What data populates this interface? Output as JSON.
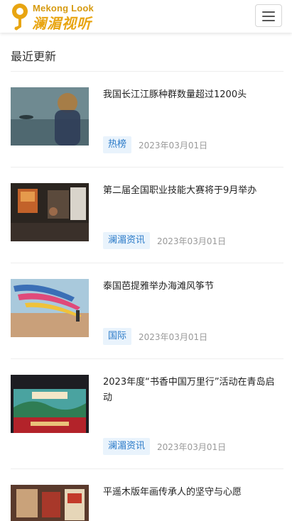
{
  "header": {
    "logo_en": "Mekong Look",
    "logo_cn": "澜湄视听",
    "menu_icon": "hamburger-menu-icon"
  },
  "section": {
    "title": "最近更新"
  },
  "articles": [
    {
      "title": "我国长江江豚种群数量超过1200头",
      "tag": "热榜",
      "date": "2023年03月01日"
    },
    {
      "title": "第二届全国职业技能大赛将于9月举办",
      "tag": "澜湄资讯",
      "date": "2023年03月01日"
    },
    {
      "title": "泰国芭提雅举办海滩风筝节",
      "tag": "国际",
      "date": "2023年03月01日"
    },
    {
      "title": "2023年度“书香中国万里行”活动在青岛启动",
      "tag": "澜湄资讯",
      "date": "2023年03月01日"
    },
    {
      "title": "平遥木版年画传承人的坚守与心愿"
    }
  ],
  "colors": {
    "accent": "#e8a512",
    "tag_bg": "#e9f3fc",
    "tag_text": "#2a7ac8"
  }
}
